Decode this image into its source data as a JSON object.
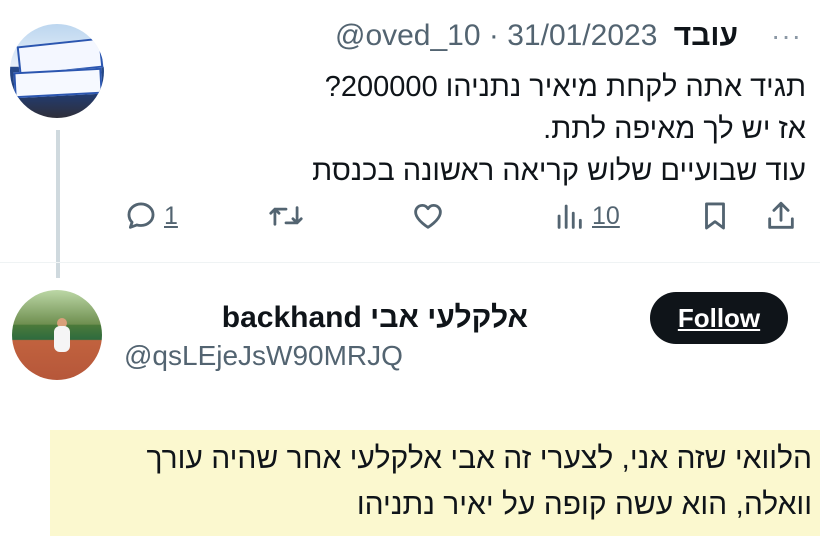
{
  "tweet": {
    "author_name": "עובד",
    "handle": "@oved_10",
    "separator": "·",
    "date": "31/01/2023",
    "more_label": "···",
    "lines": [
      "תגיד אתה לקחת מיאיר נתניהו 200000?",
      "אז יש לך מאיפה לתת.",
      "עוד שבועיים שלוש  קריאה ראשונה בכנסת"
    ],
    "actions": {
      "reply_count": "1",
      "retweet_count": "",
      "like_count": "",
      "views_count": "10"
    },
    "icons": [
      "reply-icon",
      "retweet-icon",
      "like-icon",
      "views-icon",
      "bookmark-icon",
      "share-icon"
    ]
  },
  "user_card": {
    "display_name": "אלקלעי אבי backhand",
    "handle": "@qsLEjeJsW90MRJQ",
    "follow_label": "Follow"
  },
  "reply": {
    "lines": [
      "הלוואי שזה אני, לצערי זה אבי אלקלעי אחר שהיה עורך",
      "וואלה, הוא עשה קופה על יאיר נתניהו"
    ],
    "highlight_color": "#fbf8cf"
  },
  "colors": {
    "text": "#0f1419",
    "secondary": "#536471",
    "follow_bg": "#0f1419"
  }
}
